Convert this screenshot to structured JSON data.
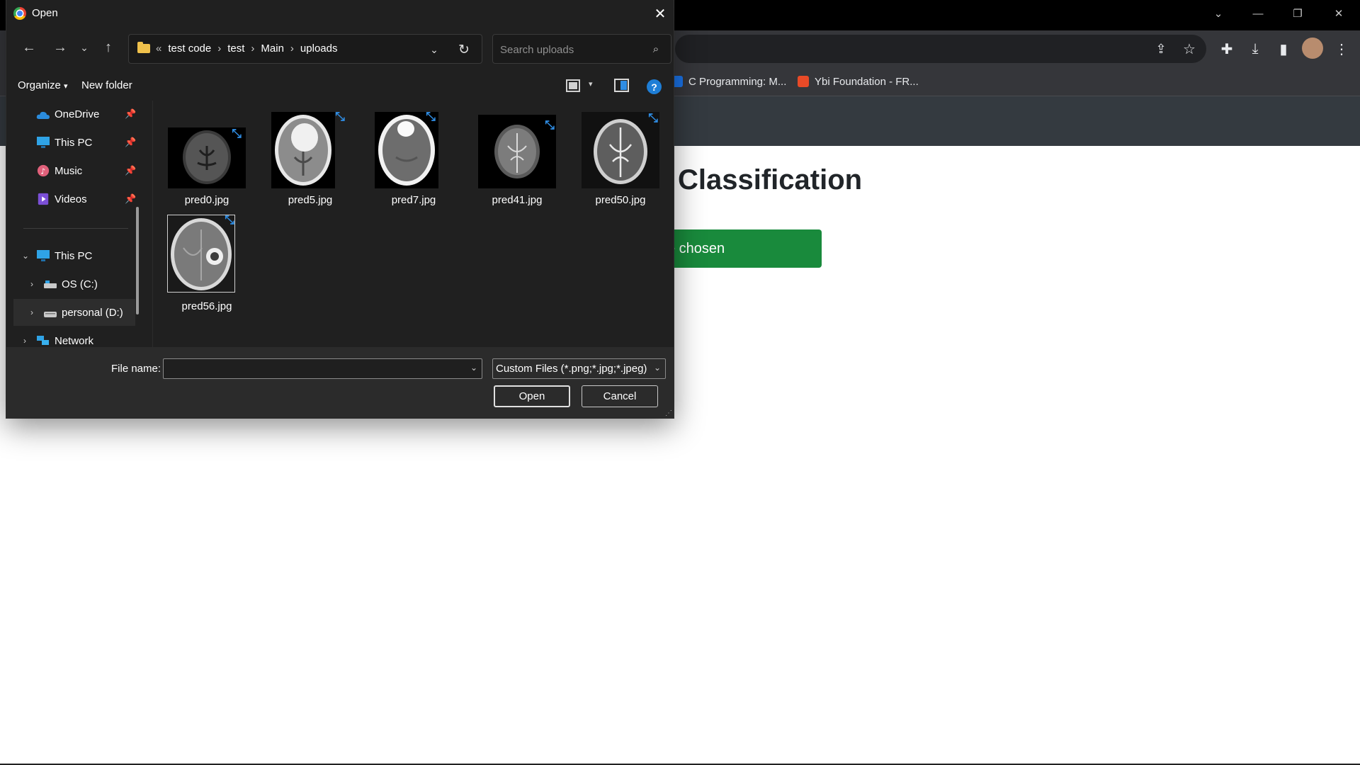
{
  "browser": {
    "bookmarks": [
      {
        "label": "C Programming: M...",
        "icon": "c-programming-icon",
        "color": "#1a73e8"
      },
      {
        "label": "Ybi Foundation - FR...",
        "icon": "ybi-foundation-icon",
        "color": "#e84a27"
      }
    ],
    "page": {
      "heading": "Classification",
      "upload_button": "e chosen",
      "accent": "#198a3c"
    }
  },
  "dialog": {
    "title": "Open",
    "address": {
      "lead": "«",
      "crumbs": [
        "test code",
        "test",
        "Main",
        "uploads"
      ]
    },
    "search": {
      "placeholder": "Search uploads"
    },
    "commands": {
      "organize": "Organize",
      "organize_caret": "▾",
      "new_folder": "New folder",
      "help": "?"
    },
    "nav_pane": {
      "quick_access": [
        {
          "label": "OneDrive",
          "icon": "onedrive-icon"
        },
        {
          "label": "This PC",
          "icon": "computer-icon"
        },
        {
          "label": "Music",
          "icon": "music-icon"
        },
        {
          "label": "Videos",
          "icon": "videos-icon"
        }
      ],
      "tree": [
        {
          "label": "This PC",
          "icon": "computer-icon",
          "expanded": true
        },
        {
          "label": "OS (C:)",
          "icon": "drive-icon"
        },
        {
          "label": "personal (D:)",
          "icon": "drive-icon",
          "selected": true
        },
        {
          "label": "Network",
          "icon": "network-icon"
        }
      ]
    },
    "files": [
      {
        "name": "pred0.jpg"
      },
      {
        "name": "pred5.jpg"
      },
      {
        "name": "pred7.jpg"
      },
      {
        "name": "pred41.jpg"
      },
      {
        "name": "pred50.jpg"
      },
      {
        "name": "pred56.jpg",
        "selected": true
      }
    ],
    "footer": {
      "file_name_label": "File name:",
      "file_name_value": "",
      "filter": "Custom Files (*.png;*.jpg;*.jpeg)",
      "open": "Open",
      "cancel": "Cancel"
    }
  }
}
